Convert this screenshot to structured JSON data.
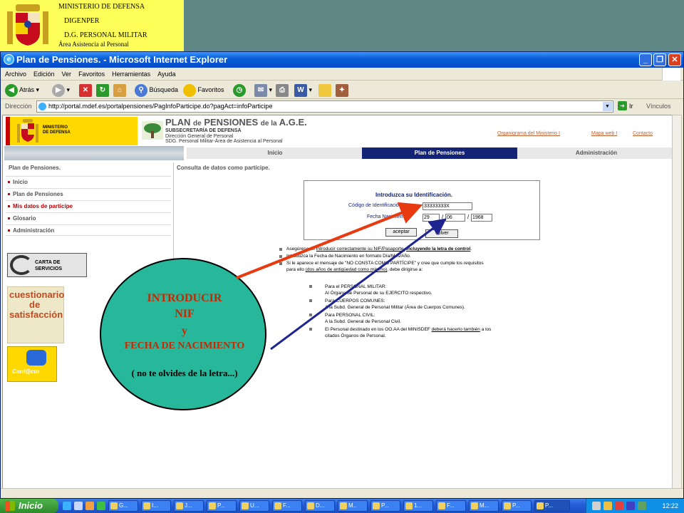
{
  "header": {
    "line1": "MINISTERIO DE DEFENSA",
    "line2": "DIGENPER",
    "line3": "D.G. PERSONAL MILITAR",
    "line4": "Área Asistencia al Personal"
  },
  "browser": {
    "title": "Plan de Pensiones. - Microsoft Internet Explorer",
    "menu": [
      "Archivo",
      "Edición",
      "Ver",
      "Favoritos",
      "Herramientas",
      "Ayuda"
    ],
    "toolbar": {
      "back": "Atrás",
      "search": "Búsqueda",
      "favorites": "Favoritos"
    },
    "address_label": "Dirección",
    "address_url": "http://portal.mdef.es/portalpensiones/PagInfoParticipe.do?pagAct=infoParticipe",
    "go_label": "Ir",
    "links_label": "Vínculos"
  },
  "site": {
    "ministerio_line1": "MINISTERIO",
    "ministerio_line2": "DE DEFENSA",
    "plan_title_a": "PLAN",
    "plan_title_b": "de",
    "plan_title_c": "PENSIONES",
    "plan_title_d": "de la",
    "plan_title_e": "A.G.E.",
    "subtitle1": "SUBSECRETARÍA DE DEFENSA",
    "subtitle2": "Dirección General de Personal",
    "subtitle3": "SDG. Personal Militar-Área de Asistencia al Personal",
    "top_links": [
      "Organigrama del Ministerio I",
      "Mapa web I",
      "Contacto"
    ],
    "nav": [
      "Inicio",
      "Plan de Pensiones",
      "Administración"
    ],
    "sidebar_title": "Plan de Pensiones.",
    "sidebar_items": [
      "Inicio",
      "Plan de Pensiones",
      "Mis datos de partícipe",
      "Glosario",
      "Administración"
    ],
    "main_title": "Consulta de datos como partícipe.",
    "carta_text_1": "CARTA DE",
    "carta_text_2": "SERVICIOS",
    "cuestionario_1": "cuestionario",
    "cuestionario_2": "de",
    "cuestionario_3": "satisfacción",
    "contacto": "Cont@cto"
  },
  "idform": {
    "heading": "Introduzca su Identificación.",
    "code_label": "Código de Identificación",
    "code_value": "33333333X",
    "dob_label": "Fecha Nacimiento",
    "day": "29",
    "month": "06",
    "year": "1968",
    "accept_label": "aceptar",
    "back_label": "Volver"
  },
  "instructions": {
    "l1a": "Asegúrese de",
    "l1b": "introducir correctamente su NIF/Pasaporte,",
    "l1c": "incluyendo la letra de control",
    "l1d": ".",
    "l2": "Introduzca la Fecha de Nacimiento en formato Día/Mes/Año.",
    "l3": "Si le aparece el mensaje de \"NO CONSTA COMO PARTÍCIPE\" y cree que cumple los requisitos",
    "l4a": "para ello",
    "l4b": "(dos años de antigüedad como mínimo)",
    "l4c": ", debe dirigirse a:",
    "s1": "Para el PERSONAL MILITAR:",
    "s1b": "Al Órgano de Personal de su EJERCITO respectivo.",
    "s2": "Para CUERPOS COMUNES:",
    "s2b": "A la Subd. General de Personal Militar (Área de Cuerpos Comunes).",
    "s3": "Para PERSONAL CIVIL:",
    "s3b": "A la Subd. General de Personal Civil.",
    "s4a": "El Personal destinado en los OO.AA del MINISDEF",
    "s4b": "deberá hacerlo también",
    "s4c": "a los",
    "s4d": "citados Órganos de Personal."
  },
  "callout": {
    "line1": "INTRODUCIR",
    "line2": "NIF",
    "line3": "y",
    "line4": "FECHA DE NACIMIENTO",
    "line5": "( no te olvides de la letra...)"
  },
  "taskbar": {
    "start": "Inicio",
    "tasks": [
      "G...",
      "I...",
      "J...",
      "P...",
      "U...",
      "F...",
      "D...",
      "M..",
      "P...",
      "1...",
      "F...",
      "M...",
      "P...",
      "P..."
    ],
    "clock": "12:22"
  },
  "colors": {
    "nav_active": "#132477",
    "callout_fill": "#27b89c",
    "callout_text": "#c62800",
    "arrow_red": "#e83a10",
    "arrow_blue": "#1e2590"
  }
}
